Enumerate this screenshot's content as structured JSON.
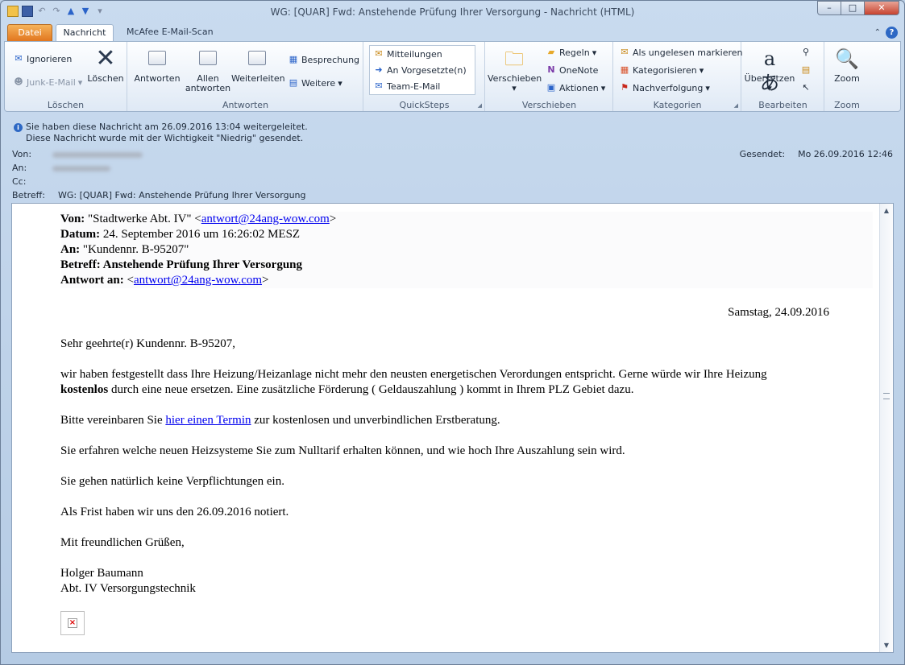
{
  "window": {
    "title": "WG: [QUAR] Fwd: Anstehende Prüfung Ihrer Versorgung  -  Nachricht (HTML)",
    "min": "–",
    "max": "□",
    "close": "✕"
  },
  "tabs": {
    "datei": "Datei",
    "nachricht": "Nachricht",
    "mcafee": "McAfee E-Mail-Scan"
  },
  "ribbon": {
    "loeschen": {
      "label": "Löschen",
      "ignorieren": "Ignorieren",
      "junk": "Junk-E-Mail",
      "loeschen": "Löschen"
    },
    "antworten": {
      "label": "Antworten",
      "antworten": "Antworten",
      "allen": "Allen antworten",
      "weiterleiten": "Weiterleiten",
      "besprechung": "Besprechung",
      "weitere": "Weitere"
    },
    "quicksteps": {
      "label": "QuickSteps",
      "items": [
        "Mitteilungen",
        "An Vorgesetzte(n)",
        "Team-E-Mail"
      ]
    },
    "verschieben": {
      "label": "Verschieben",
      "verschieben": "Verschieben",
      "regeln": "Regeln",
      "onenote": "OneNote",
      "aktionen": "Aktionen"
    },
    "kategorien": {
      "label": "Kategorien",
      "ungelesen": "Als ungelesen markieren",
      "kategorisieren": "Kategorisieren",
      "nachverfolgung": "Nachverfolgung"
    },
    "bearbeiten": {
      "label": "Bearbeiten",
      "uebersetzen": "Übersetzen"
    },
    "zoom": {
      "label": "Zoom",
      "zoom": "Zoom"
    }
  },
  "header": {
    "info1": "Sie haben diese Nachricht am 26.09.2016 13:04 weitergeleitet.",
    "info2": "Diese Nachricht wurde mit der Wichtigkeit \"Niedrig\" gesendet.",
    "von_label": "Von:",
    "an_label": "An:",
    "cc_label": "Cc:",
    "betreff_label": "Betreff:",
    "betreff": "WG: [QUAR] Fwd: Anstehende Prüfung Ihrer Versorgung",
    "gesendet_label": "Gesendet:",
    "gesendet": "Mo 26.09.2016 12:46"
  },
  "mail": {
    "von_label": "Von:",
    "von_name": " \"Stadtwerke Abt. IV\" <",
    "von_email": "antwort@24ang-wow.com",
    "von_close": ">",
    "datum_label": "Datum:",
    "datum": " 24. September 2016 um 16:26:02 MESZ",
    "an_label": "An:",
    "an": " \"Kundennr. B-95207\"",
    "betreff": "Betreff: Anstehende Prüfung Ihrer Versorgung",
    "antwort_label": "Antwort an:",
    "antwort_open": " <",
    "antwort_email": "antwort@24ang-wow.com",
    "antwort_close": ">",
    "date": "Samstag, 24.09.2016",
    "greeting": "Sehr geehrte(r) Kundennr. B-95207,",
    "p1a": "wir haben festgestellt dass Ihre Heizung/Heizanlage nicht mehr den neusten energetischen Verordungen entspricht. Gerne würde wir Ihre Heizung",
    "p1bold": "kostenlos",
    "p1b": " durch eine neue ersetzen. Eine zusätzliche Förderung ( Geldauszahlung ) kommt in Ihrem PLZ Gebiet dazu.",
    "p2a": "Bitte vereinbaren Sie ",
    "p2link": "hier einen Termin",
    "p2b": " zur kostenlosen und unverbindlichen Erstberatung.",
    "p3": "Sie erfahren welche neuen Heizsysteme Sie zum Nulltarif erhalten können, und wie hoch Ihre Auszahlung sein wird.",
    "p4": "Sie gehen natürlich keine Verpflichtungen ein.",
    "p5": "Als Frist haben wir uns den 26.09.2016 notiert.",
    "closing": "Mit freundlichen Grüßen,",
    "sig1": "Holger Baumann",
    "sig2": "Abt. IV Versorgungstechnik"
  }
}
